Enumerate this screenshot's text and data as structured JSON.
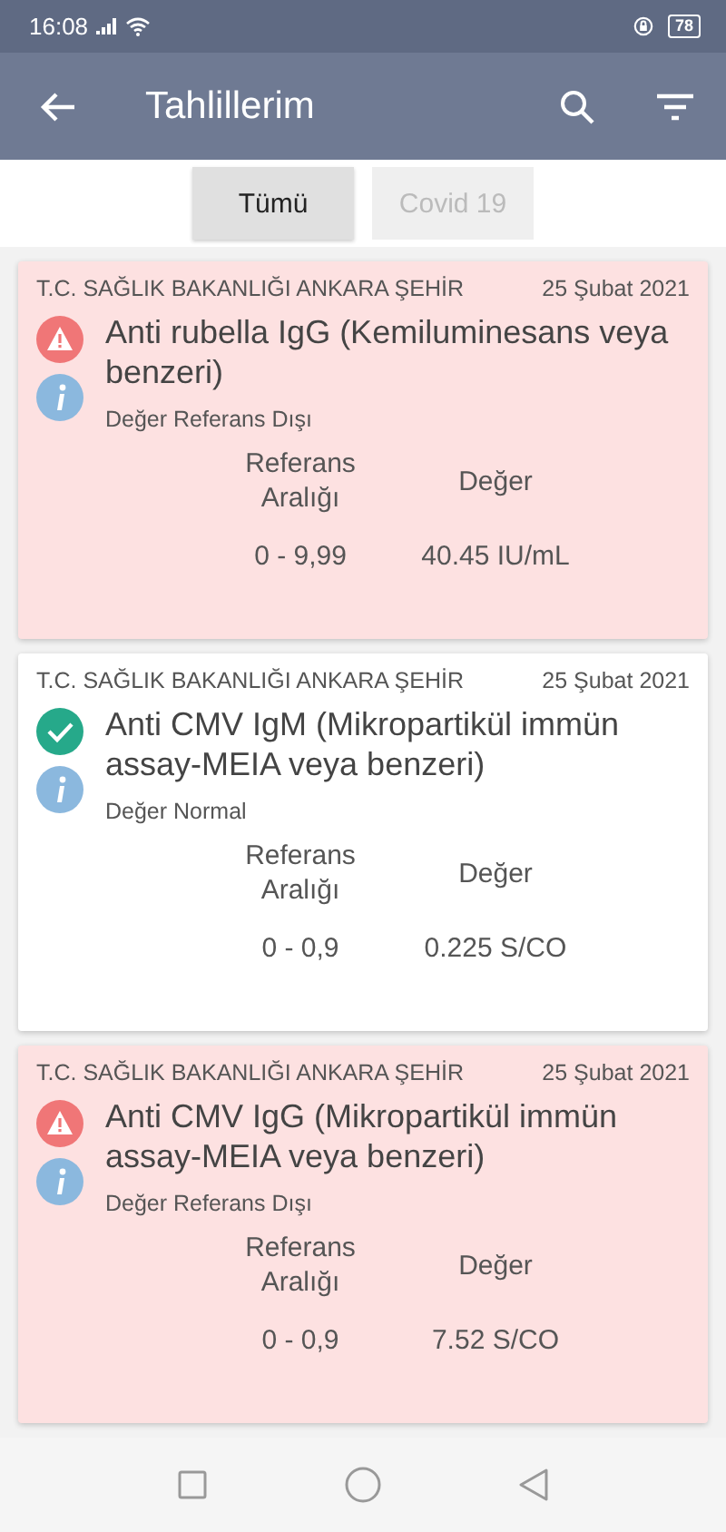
{
  "status_bar": {
    "time": "16:08",
    "battery": "78"
  },
  "app_bar": {
    "title": "Tahlillerim"
  },
  "tabs": [
    {
      "label": "Tümü",
      "selected": true
    },
    {
      "label": "Covid 19",
      "selected": false
    }
  ],
  "results": [
    {
      "kind": "alert",
      "hospital": "T.C. SAĞLIK BAKANLIĞI ANKARA ŞEHİR",
      "date": "25 Şubat 2021",
      "test": "Anti rubella IgG (Kemiluminesans veya benzeri)",
      "status": "Değer Referans Dışı",
      "reference_label": "Referans Aralığı",
      "value_label": "Değer",
      "reference": "0 - 9,99",
      "value": "40.45 IU/mL"
    },
    {
      "kind": "normal",
      "hospital": "T.C. SAĞLIK BAKANLIĞI ANKARA ŞEHİR",
      "date": "25 Şubat 2021",
      "test": "Anti CMV IgM (Mikropartikül immün assay-MEIA veya benzeri)",
      "status": "Değer Normal",
      "reference_label": "Referans Aralığı",
      "value_label": "Değer",
      "reference": "0 - 0,9",
      "value": "0.225 S/CO"
    },
    {
      "kind": "alert",
      "hospital": "T.C. SAĞLIK BAKANLIĞI ANKARA ŞEHİR",
      "date": "25 Şubat 2021",
      "test": "Anti CMV IgG (Mikropartikül immün assay-MEIA veya benzeri)",
      "status": "Değer Referans Dışı",
      "reference_label": "Referans Aralığı",
      "value_label": "Değer",
      "reference": "0 - 0,9",
      "value": "7.52 S/CO"
    }
  ]
}
